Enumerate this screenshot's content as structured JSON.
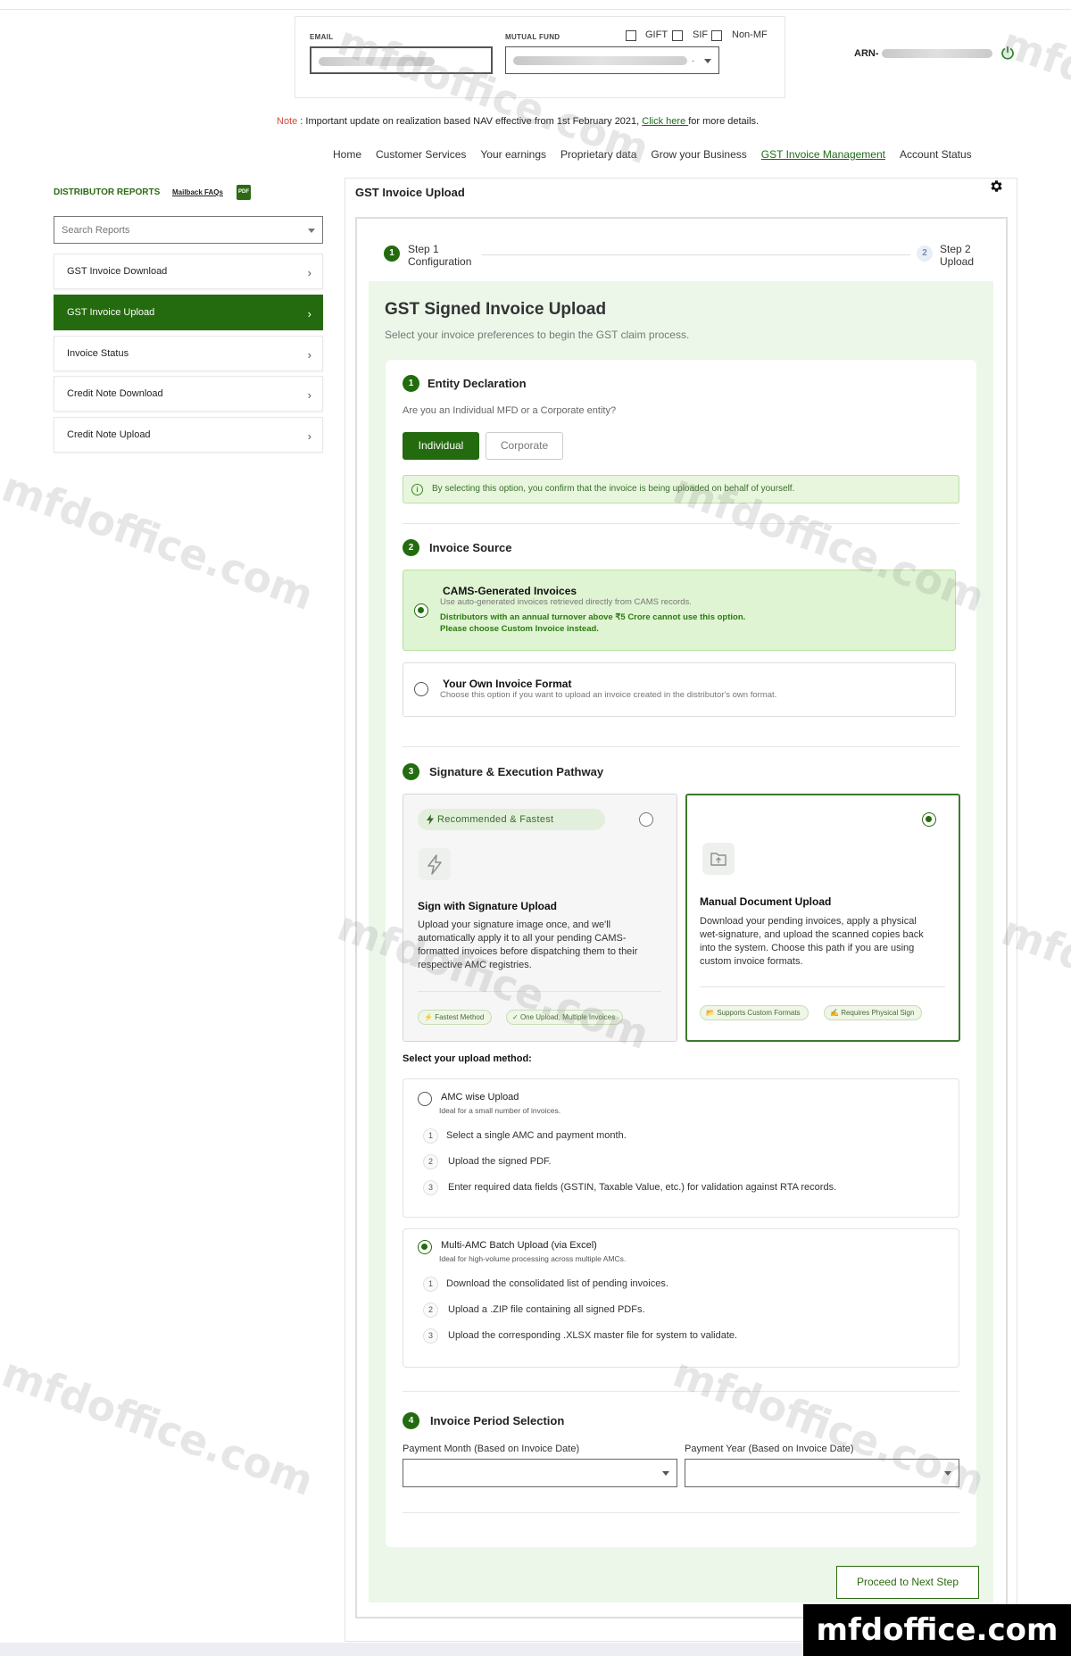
{
  "header": {
    "email_label": "EMAIL",
    "mf_label": "MUTUAL FUND",
    "mf_suffix": ".",
    "checks": [
      "GIFT",
      "SIF",
      "Non-MF"
    ],
    "arn_label": "ARN-"
  },
  "note": {
    "prefix": "Note",
    "text": " : Important update on realization based NAV effective from 1st February 2021, ",
    "link": "Click here ",
    "suffix": "for more details."
  },
  "nav": [
    "Home",
    "Customer Services",
    "Your earnings",
    "Proprietary data",
    "Grow your Business",
    "GST Invoice Management",
    "Account Status"
  ],
  "sidebar": {
    "title": "DISTRIBUTOR REPORTS",
    "faq": "Mailback FAQs",
    "pdf": "PDF",
    "search_placeholder": "Search Reports",
    "items": [
      {
        "label": "GST Invoice Download"
      },
      {
        "label": "GST Invoice Upload"
      },
      {
        "label": "Invoice Status"
      },
      {
        "label": "Credit Note Download"
      },
      {
        "label": "Credit Note Upload"
      }
    ],
    "chevron": "›"
  },
  "main": {
    "title": "GST Invoice Upload",
    "steps": [
      {
        "num": "1",
        "line1": "Step 1",
        "line2": "Configuration"
      },
      {
        "num": "2",
        "line1": "Step 2",
        "line2": "Upload"
      }
    ],
    "heading": "GST Signed Invoice Upload",
    "subheading": "Select your invoice preferences to begin the GST claim process."
  },
  "entity": {
    "num": "1",
    "title": "Entity Declaration",
    "question": "Are you an Individual MFD or a Corporate entity?",
    "individual": "Individual",
    "corporate": "Corporate",
    "info_icon": "i",
    "info": "By selecting this option, you confirm that the invoice is being uploaded on behalf of yourself."
  },
  "source": {
    "num": "2",
    "title": "Invoice Source",
    "cams_title": "CAMS-Generated Invoices",
    "cams_sub": "Use auto-generated invoices retrieved directly from CAMS records.",
    "cams_warn1": "Distributors with an annual turnover above ₹5 Crore cannot use this option.",
    "cams_warn2": "Please choose Custom Invoice instead.",
    "own_title": "Your Own Invoice Format",
    "own_sub": "Choose this option if you want to upload an invoice created in the distributor's own format."
  },
  "pathway": {
    "num": "3",
    "title": "Signature & Execution Pathway",
    "rec": "Recommended & Fastest",
    "sig_title": "Sign with Signature Upload",
    "sig_desc": "Upload your signature image once, and we'll automatically apply it to all your pending CAMS-formatted invoices before dispatching them to their respective AMC registries.",
    "sig_tags": [
      "Fastest Method",
      "One Upload, Multiple Invoices"
    ],
    "man_title": "Manual Document Upload",
    "man_desc": "Download your pending invoices, apply a physical wet-signature, and upload the scanned copies back into the system. Choose this path if you are using custom invoice formats.",
    "man_tags": [
      "Supports Custom Formats",
      "Requires Physical Sign"
    ]
  },
  "upload_method": {
    "label": "Select your upload method:",
    "options": [
      {
        "title": "AMC wise Upload",
        "sub": "Ideal for a small number of invoices.",
        "steps": [
          {
            "n": "1",
            "t": "Select a single AMC and payment month."
          },
          {
            "n": "2",
            "t": "Upload the signed PDF."
          },
          {
            "n": "3",
            "t": "Enter required data fields (GSTIN, Taxable Value, etc.) for validation against RTA records."
          }
        ]
      },
      {
        "title": "Multi-AMC Batch Upload (via Excel)",
        "sub": "Ideal for high-volume processing across multiple AMCs.",
        "steps": [
          {
            "n": "1",
            "t": "Download the consolidated list of pending invoices."
          },
          {
            "n": "2",
            "t": "Upload a .ZIP file containing all signed PDFs."
          },
          {
            "n": "3",
            "t": "Upload the corresponding .XLSX master file for system to validate."
          }
        ]
      }
    ]
  },
  "period": {
    "num": "4",
    "title": "Invoice Period Selection",
    "month_label": "Payment Month (Based on Invoice Date)",
    "year_label": "Payment Year (Based on Invoice Date)"
  },
  "proceed": "Proceed to Next Step",
  "watermark": "mfdoffice.com",
  "banner": "mfdoffice.com",
  "colors": {
    "brand_green": "#236b0e",
    "light_green": "#ecf7ea"
  }
}
